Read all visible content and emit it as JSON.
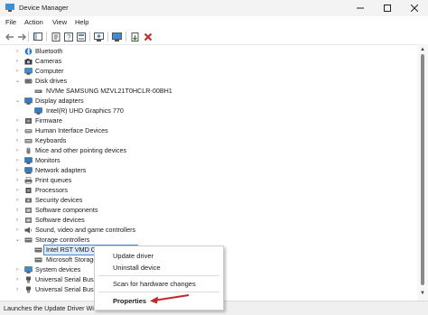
{
  "window": {
    "title": "Device Manager"
  },
  "menu": [
    "File",
    "Action",
    "View",
    "Help"
  ],
  "icons": {
    "bluetooth": "#1f6fd0",
    "camera": "#3b3b3b",
    "computer": "#3a8fd6",
    "disk": "#6b6b6b",
    "display": "#2f7fd0",
    "firmware": "#555555",
    "hid": "#8a8a8a",
    "keyboard": "#6b6b6b",
    "mouse": "#7a7a7a",
    "monitor": "#2f7fd0",
    "network": "#2f7fd0",
    "printer": "#6b6b6b",
    "processor": "#4a4a4a",
    "security": "#6b6b6b",
    "software": "#777777",
    "sound": "#555555",
    "storage": "#6b6b6b",
    "system": "#3a8fd6",
    "usb": "#555555"
  },
  "tree": [
    {
      "label": "Bluetooth"
    },
    {
      "label": "Cameras"
    },
    {
      "label": "Computer"
    },
    {
      "label": "Disk drives"
    },
    {
      "label": "NVMe SAMSUNG MZVL21T0HCLR-00BH1"
    },
    {
      "label": "Display adapters"
    },
    {
      "label": "Intel(R) UHD Graphics 770"
    },
    {
      "label": "Firmware"
    },
    {
      "label": "Human Interface Devices"
    },
    {
      "label": "Keyboards"
    },
    {
      "label": "Mice and other pointing devices"
    },
    {
      "label": "Monitors"
    },
    {
      "label": "Network adapters"
    },
    {
      "label": "Print queues"
    },
    {
      "label": "Processors"
    },
    {
      "label": "Security devices"
    },
    {
      "label": "Software components"
    },
    {
      "label": "Software devices"
    },
    {
      "label": "Sound, video and game controllers"
    },
    {
      "label": "Storage controllers"
    },
    {
      "label": "Intel RST VMD Controller 467F"
    },
    {
      "label": "Microsoft Storage Spaces Controller"
    },
    {
      "label": "System devices"
    },
    {
      "label": "Universal Serial Bus controllers"
    },
    {
      "label": "Universal Serial Bus devices"
    }
  ],
  "context_menu": {
    "update": "Update driver",
    "uninstall": "Uninstall device",
    "scan": "Scan for hardware changes",
    "properties": "Properties"
  },
  "status": "Launches the Update Driver Wizard for the selected device."
}
